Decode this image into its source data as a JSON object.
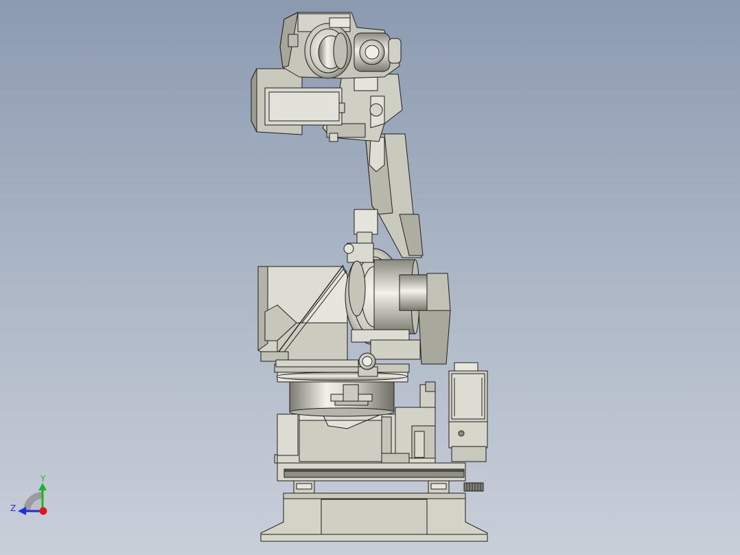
{
  "viewport": {
    "background_top": "#8C9AB0",
    "background_bottom": "#C9CFD9"
  },
  "model": {
    "part_fill": "#D9D9CE",
    "part_shade": "#A8A89C",
    "edge_color": "#1E1E1E",
    "chrome_light": "#F4F4EE",
    "chrome_dark": "#6E6E66"
  },
  "triad": {
    "y_label": "Y",
    "z_label": "Z",
    "y_color": "#1FB41F",
    "z_color": "#1E2FD8",
    "x_color": "#E0161A"
  }
}
